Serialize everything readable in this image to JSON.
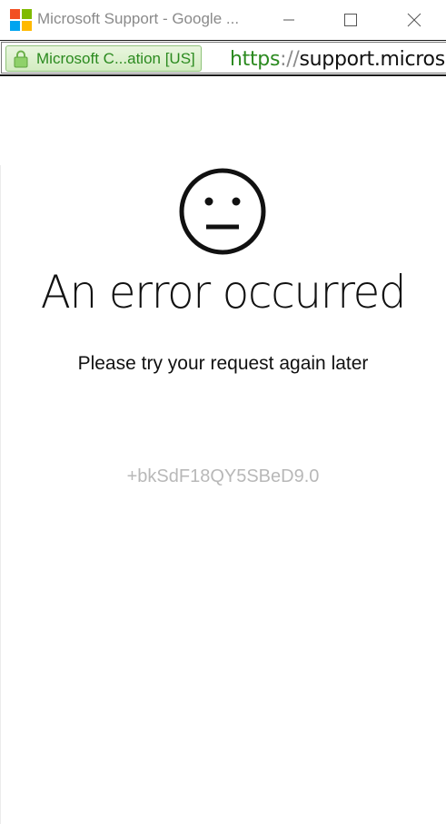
{
  "window": {
    "title": "Microsoft Support - Google ...",
    "logo": "microsoft-logo",
    "logo_colors": [
      "#f25022",
      "#7fba00",
      "#00a4ef",
      "#ffb900"
    ],
    "controls": {
      "minimize": "minimize-icon",
      "maximize": "maximize-icon",
      "close": "close-icon"
    }
  },
  "address_bar": {
    "security_badge": "Microsoft C...ation [US]",
    "security_icon": "lock-icon",
    "url_scheme": "https",
    "url_separator": "://",
    "url_host": "support.micros",
    "secure_color": "#2b8a1f"
  },
  "page": {
    "icon": "neutral-face-icon",
    "error_title": "An error occurred",
    "error_message": "Please try your request again later",
    "error_code": "+bkSdF18QY5SBeD9.0"
  }
}
